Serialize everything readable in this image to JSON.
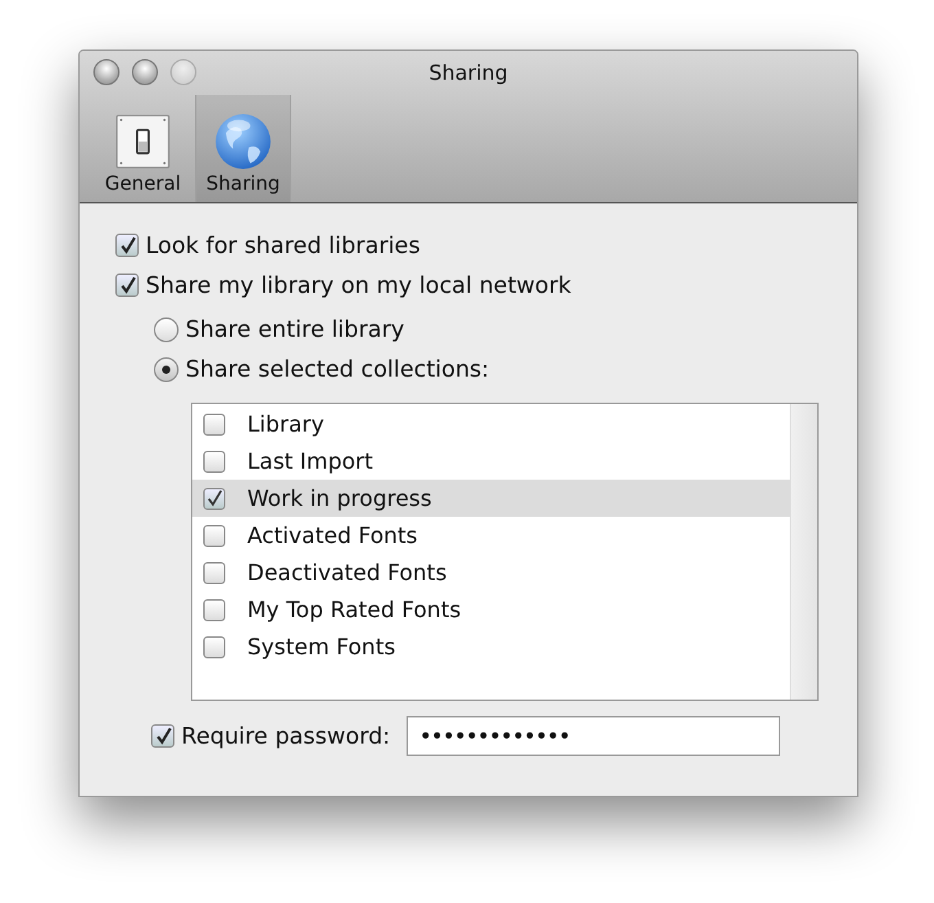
{
  "window": {
    "title": "Sharing",
    "controls": [
      {
        "disabled": false
      },
      {
        "disabled": false
      },
      {
        "disabled": true
      }
    ]
  },
  "toolbar": [
    {
      "label": "General",
      "kind": "switch",
      "selected": false
    },
    {
      "label": "Sharing",
      "kind": "globe",
      "selected": true
    }
  ],
  "options": [
    {
      "label": "Look for shared libraries",
      "checked": true
    },
    {
      "label": "Share my library on my local network",
      "checked": true
    }
  ],
  "share_mode": [
    {
      "label": "Share entire library",
      "selected": false
    },
    {
      "label": "Share selected collections:",
      "selected": true
    }
  ],
  "collections": [
    {
      "label": "Library",
      "checked": false,
      "selected": false
    },
    {
      "label": "Last Import",
      "checked": false,
      "selected": false
    },
    {
      "label": "Work in progress",
      "checked": true,
      "selected": true
    },
    {
      "label": "Activated Fonts",
      "checked": false,
      "selected": false
    },
    {
      "label": "Deactivated Fonts",
      "checked": false,
      "selected": false
    },
    {
      "label": "My Top Rated Fonts",
      "checked": false,
      "selected": false
    },
    {
      "label": "System Fonts",
      "checked": false,
      "selected": false
    }
  ],
  "password": {
    "label": "Require password:",
    "checked": true,
    "value": "•••••••••••••"
  }
}
